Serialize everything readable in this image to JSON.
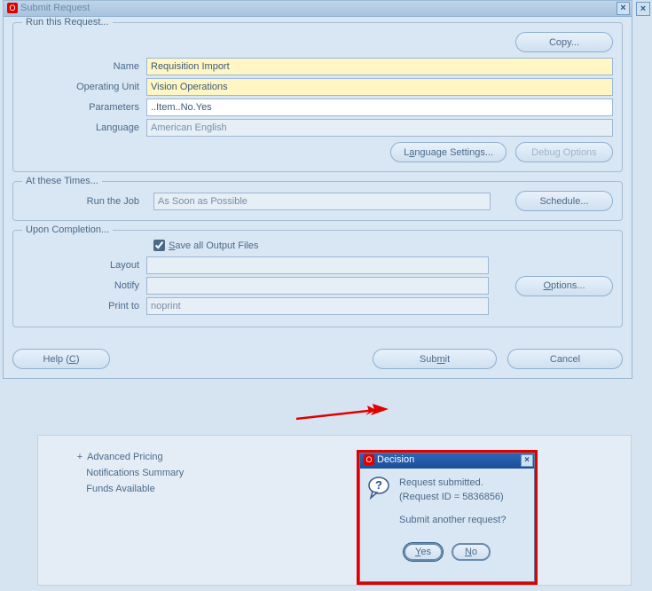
{
  "window": {
    "title": "Submit Request"
  },
  "copy_button": "Copy...",
  "run_group": {
    "title": "Run this Request...",
    "name_label": "Name",
    "name_value": "Requisition Import",
    "ou_label": "Operating Unit",
    "ou_value": "Vision Operations",
    "params_label": "Parameters",
    "params_value": "..Item..No.Yes",
    "lang_label": "Language",
    "lang_value": "American English",
    "lang_settings_btn": "Language Settings...",
    "debug_btn": "Debug Options"
  },
  "times_group": {
    "title": "At these Times...",
    "run_label": "Run the Job",
    "run_value": "As Soon as Possible",
    "schedule_btn": "Schedule..."
  },
  "completion_group": {
    "title": "Upon Completion...",
    "save_all": "Save all Output Files",
    "layout_label": "Layout",
    "layout_value": "",
    "notify_label": "Notify",
    "notify_value": "",
    "print_label": "Print to",
    "print_value": "noprint",
    "options_btn": "Options..."
  },
  "footer": {
    "help": "Help (C)",
    "submit": "Submit",
    "cancel": "Cancel"
  },
  "bg_list": {
    "item1": "Advanced Pricing",
    "item2": "Notifications Summary",
    "item3": "Funds Available"
  },
  "dialog": {
    "title": "Decision",
    "line1": "Request submitted.",
    "line2": "(Request ID = 5836856)",
    "line3": "Submit another request?",
    "yes": "Yes",
    "no": "No"
  }
}
